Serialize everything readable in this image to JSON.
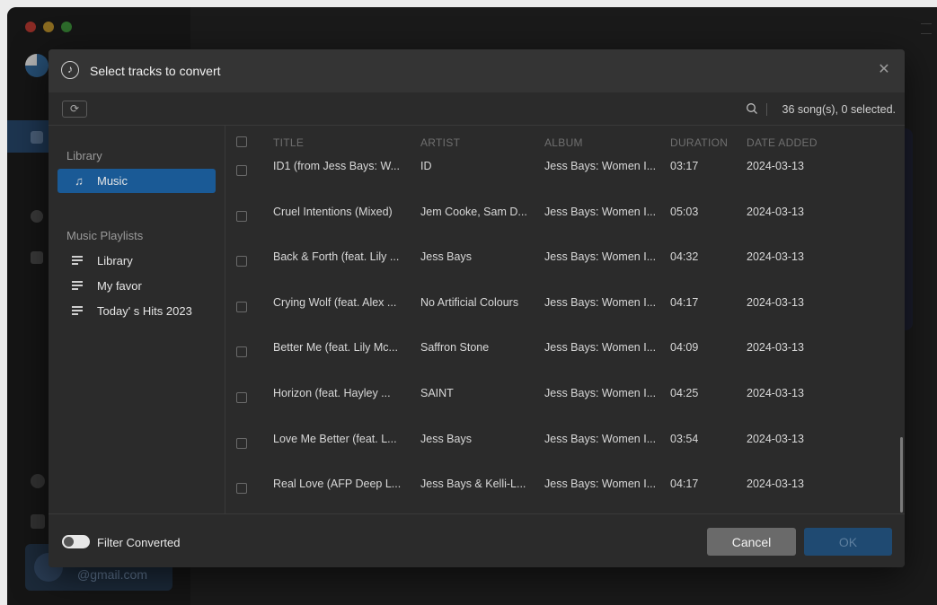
{
  "background_app": {
    "account_email": "@gmail.com"
  },
  "dialog": {
    "title": "Select tracks to convert",
    "title_icon": "music-note-circle-icon",
    "close_icon": "close-icon",
    "toolbar": {
      "refresh_icon": "refresh-icon",
      "search_icon": "search-icon",
      "song_count": "36 song(s), 0 selected."
    },
    "sidebar": {
      "library_label": "Library",
      "library_items": [
        {
          "label": "Music",
          "icon": "music-note-icon",
          "active": true
        }
      ],
      "playlists_label": "Music Playlists",
      "playlists": [
        {
          "label": "Library",
          "icon": "playlist-icon"
        },
        {
          "label": "My favor",
          "icon": "playlist-icon"
        },
        {
          "label": "Today' s Hits 2023",
          "icon": "playlist-icon"
        }
      ]
    },
    "table": {
      "columns": [
        "TITLE",
        "ARTIST",
        "ALBUM",
        "DURATION",
        "DATE ADDED"
      ],
      "rows": [
        {
          "title": "ID1 (from Jess Bays: W...",
          "artist": "ID",
          "album": "Jess Bays: Women I...",
          "duration": "03:17",
          "date_added": "2024-03-13"
        },
        {
          "title": "Cruel Intentions (Mixed)",
          "artist": "Jem Cooke, Sam D...",
          "album": "Jess Bays: Women I...",
          "duration": "05:03",
          "date_added": "2024-03-13"
        },
        {
          "title": "Back & Forth (feat. Lily ...",
          "artist": "Jess Bays",
          "album": "Jess Bays: Women I...",
          "duration": "04:32",
          "date_added": "2024-03-13"
        },
        {
          "title": "Crying Wolf (feat. Alex ...",
          "artist": "No Artificial Colours",
          "album": "Jess Bays: Women I...",
          "duration": "04:17",
          "date_added": "2024-03-13"
        },
        {
          "title": "Better Me (feat. Lily Mc...",
          "artist": "Saffron Stone",
          "album": "Jess Bays: Women I...",
          "duration": "04:09",
          "date_added": "2024-03-13"
        },
        {
          "title": "Horizon (feat. Hayley ...",
          "artist": "SAINT",
          "album": "Jess Bays: Women I...",
          "duration": "04:25",
          "date_added": "2024-03-13"
        },
        {
          "title": "Love Me Better (feat. L...",
          "artist": "Jess Bays",
          "album": "Jess Bays: Women I...",
          "duration": "03:54",
          "date_added": "2024-03-13"
        },
        {
          "title": "Real Love (AFP Deep L...",
          "artist": "Jess Bays & Kelli-L...",
          "album": "Jess Bays: Women I...",
          "duration": "04:17",
          "date_added": "2024-03-13"
        }
      ]
    },
    "footer": {
      "filter_label": "Filter Converted",
      "filter_on": false,
      "cancel_label": "Cancel",
      "ok_label": "OK"
    }
  },
  "colors": {
    "accent": "#1a5a96",
    "dialog_bg": "#2b2b2b",
    "header_bg": "#343434",
    "ok_disabled": "#1f4a72"
  }
}
